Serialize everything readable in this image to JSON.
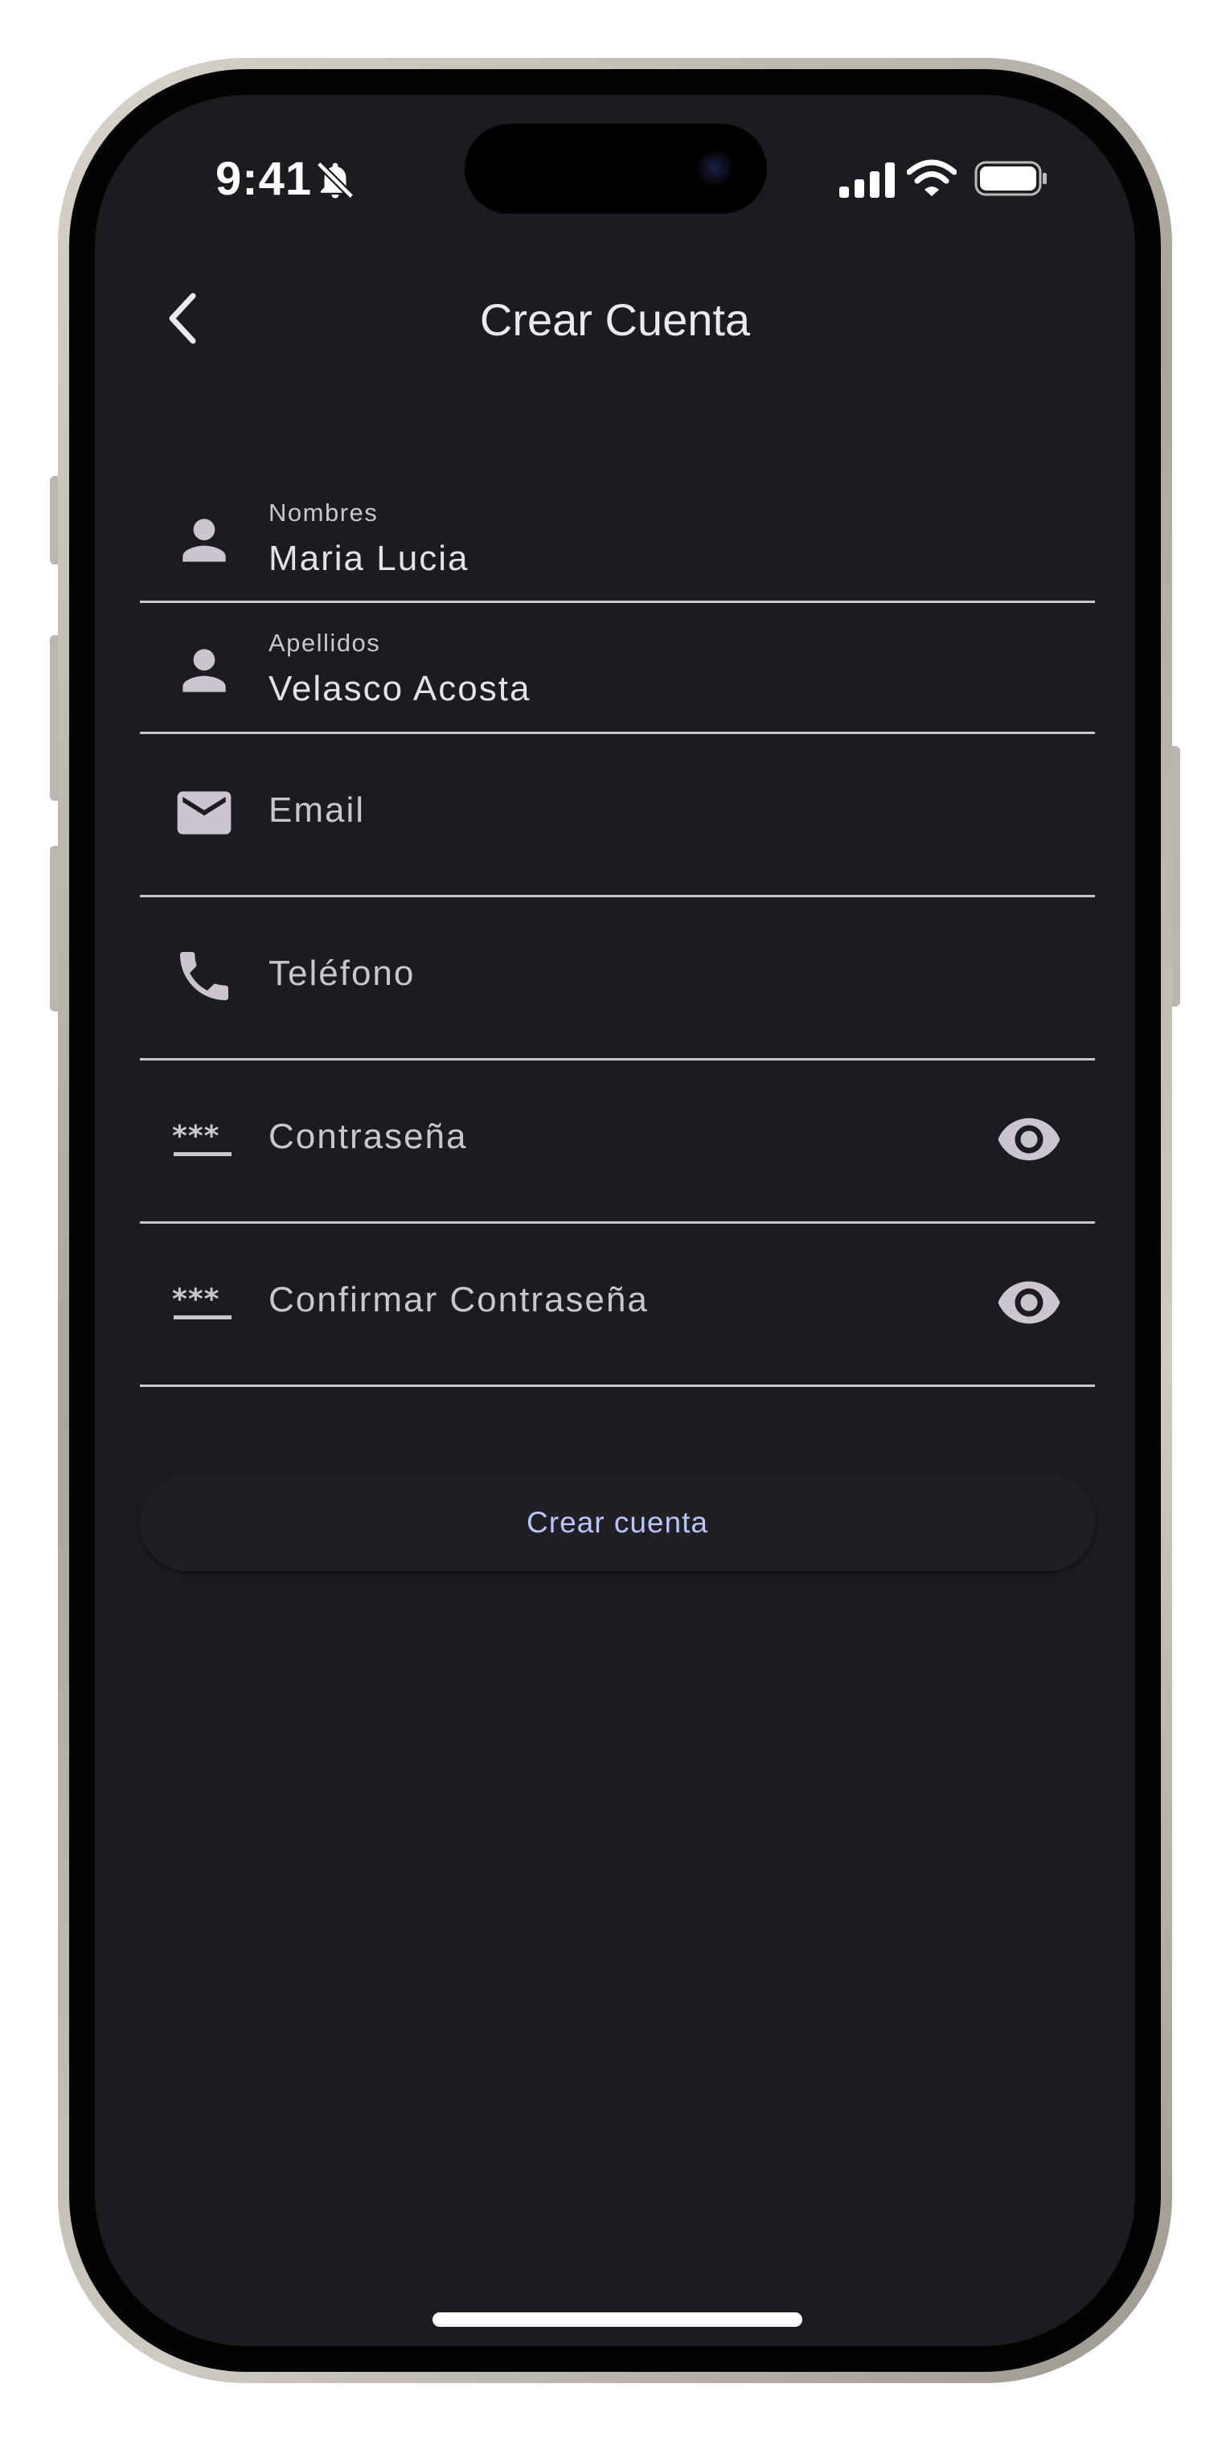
{
  "status_bar": {
    "time": "9:41",
    "icons": [
      "bell-slash-icon",
      "cellular-signal-icon",
      "wifi-icon",
      "battery-icon"
    ]
  },
  "app_bar": {
    "title": "Crear Cuenta",
    "back_icon": "chevron-left-icon"
  },
  "form": {
    "nombres": {
      "label": "Nombres",
      "value": "Maria Lucia",
      "icon": "person-icon"
    },
    "apellidos": {
      "label": "Apellidos",
      "value": "Velasco Acosta",
      "icon": "person-icon"
    },
    "email": {
      "placeholder": "Email",
      "icon": "mail-icon"
    },
    "telefono": {
      "placeholder": "Teléfono",
      "icon": "phone-icon"
    },
    "contrasena": {
      "placeholder": "Contraseña",
      "icon": "password-icon",
      "toggle_icon": "eye-icon"
    },
    "confirmar": {
      "placeholder": "Confirmar Contraseña",
      "icon": "password-icon",
      "toggle_icon": "eye-icon"
    }
  },
  "submit": {
    "label": "Crear cuenta"
  },
  "colors": {
    "screen_background": "#1c1b20",
    "underline": "#c9c5cf",
    "button_text": "#b9c3ff",
    "text_primary": "#e6e1e9"
  }
}
